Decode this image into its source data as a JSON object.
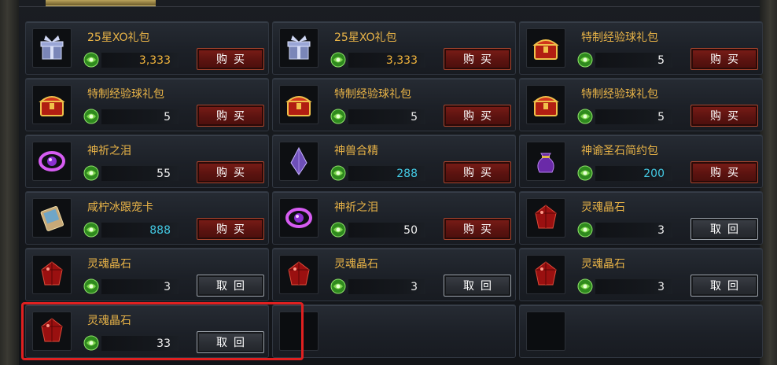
{
  "cells": [
    {
      "name": "25星XO礼包",
      "price": "3,333",
      "price_color": "gold",
      "button": "购买",
      "button_style": "red",
      "icon": "gift-box-icon"
    },
    {
      "name": "25星XO礼包",
      "price": "3,333",
      "price_color": "gold",
      "button": "购买",
      "button_style": "red",
      "icon": "gift-box-icon"
    },
    {
      "name": "特制经验球礼包",
      "price": "5",
      "price_color": "white",
      "button": "购买",
      "button_style": "red",
      "icon": "treasure-chest-icon"
    },
    {
      "name": "特制经验球礼包",
      "price": "5",
      "price_color": "white",
      "button": "购买",
      "button_style": "red",
      "icon": "treasure-chest-icon"
    },
    {
      "name": "特制经验球礼包",
      "price": "5",
      "price_color": "white",
      "button": "购买",
      "button_style": "red",
      "icon": "treasure-chest-icon"
    },
    {
      "name": "特制经验球礼包",
      "price": "5",
      "price_color": "white",
      "button": "购买",
      "button_style": "red",
      "icon": "treasure-chest-icon"
    },
    {
      "name": "神祈之泪",
      "price": "55",
      "price_color": "white",
      "button": "购买",
      "button_style": "red",
      "icon": "purple-orb-icon"
    },
    {
      "name": "神兽合精",
      "price": "288",
      "price_color": "cyan",
      "button": "购买",
      "button_style": "red",
      "icon": "purple-crystal-icon"
    },
    {
      "name": "神谕圣石简约包",
      "price": "200",
      "price_color": "cyan",
      "button": "购买",
      "button_style": "red",
      "icon": "purple-pouch-icon"
    },
    {
      "name": "咸柠冰跟宠卡",
      "price": "888",
      "price_color": "cyan",
      "button": "购买",
      "button_style": "red",
      "icon": "pet-card-icon"
    },
    {
      "name": "神祈之泪",
      "price": "50",
      "price_color": "white",
      "button": "购买",
      "button_style": "red",
      "icon": "purple-orb-icon"
    },
    {
      "name": "灵魂晶石",
      "price": "3",
      "price_color": "white",
      "button": "取回",
      "button_style": "gray",
      "icon": "red-gem-icon"
    },
    {
      "name": "灵魂晶石",
      "price": "3",
      "price_color": "white",
      "button": "取回",
      "button_style": "gray",
      "icon": "red-gem-icon"
    },
    {
      "name": "灵魂晶石",
      "price": "3",
      "price_color": "white",
      "button": "取回",
      "button_style": "gray",
      "icon": "red-gem-icon"
    },
    {
      "name": "灵魂晶石",
      "price": "3",
      "price_color": "white",
      "button": "取回",
      "button_style": "gray",
      "icon": "red-gem-icon"
    },
    {
      "name": "灵魂晶石",
      "price": "33",
      "price_color": "white",
      "button": "取回",
      "button_style": "gray",
      "icon": "red-gem-icon"
    },
    {
      "empty": true
    },
    {
      "empty": true
    }
  ],
  "colors": {
    "accent": "#e8b347",
    "highlight": "#e02020",
    "cyan": "#43c9e3"
  }
}
